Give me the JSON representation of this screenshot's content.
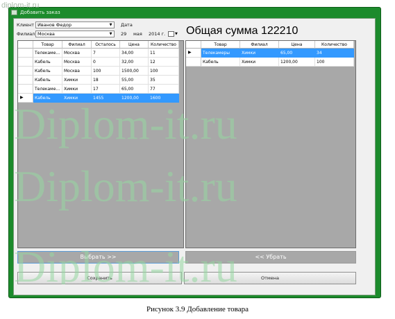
{
  "window": {
    "title": "Добавить заказ"
  },
  "form": {
    "client_label": "Клиент",
    "client_value": "Иванов Федор",
    "branch_label": "Филиал",
    "branch_value": "Москва",
    "date_label": "Дата",
    "date_day": "29",
    "date_month": "мая",
    "date_year": "2014 г."
  },
  "total": {
    "label": "Общая сумма 122210"
  },
  "left_grid": {
    "columns": [
      "Товар",
      "Филиал",
      "Осталось",
      "Цена",
      "Количество"
    ],
    "rows": [
      [
        "Телекаме...",
        "Москва",
        "7",
        "34,00",
        "11"
      ],
      [
        "Кабель",
        "Москва",
        "0",
        "32,00",
        "12"
      ],
      [
        "Кабель",
        "Москва",
        "100",
        "1500,00",
        "100"
      ],
      [
        "Кабель",
        "Химки",
        "18",
        "55,00",
        "35"
      ],
      [
        "Телекаме...",
        "Химки",
        "17",
        "65,00",
        "77"
      ],
      [
        "Кабель",
        "Химки",
        "1455",
        "1200,00",
        "1600"
      ]
    ],
    "selected_row": 5
  },
  "right_grid": {
    "columns": [
      "Товар",
      "Филиал",
      "Цена",
      "Количество"
    ],
    "rows": [
      [
        "Телекамеры",
        "Химки",
        "65,00",
        "34"
      ],
      [
        "Кабель",
        "Химки",
        "1200,00",
        "100"
      ]
    ],
    "selected_row": 0
  },
  "buttons": {
    "select": "Выбрать >>",
    "remove": "<< Убрать",
    "save": "Сохранить",
    "cancel": "Отмена"
  },
  "caption": "Рисунок 3.9 Добавление товара",
  "watermark": {
    "text": "Diplom-it.ru",
    "small": "diplom-it.ru"
  },
  "icons": {
    "dropdown": "chevron-down-icon",
    "calendar": "calendar-icon",
    "row_pointer": "row-pointer-icon"
  }
}
